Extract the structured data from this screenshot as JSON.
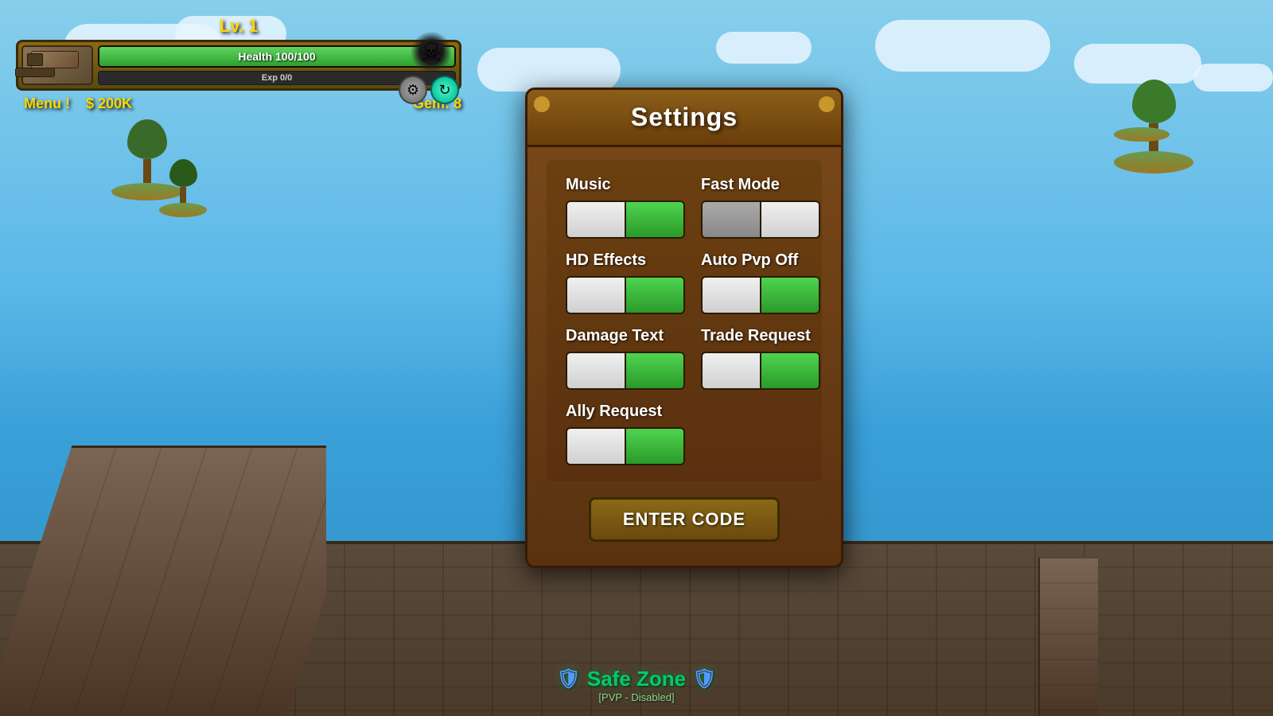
{
  "background": {
    "sky_top": "#87CEEB",
    "sky_bottom": "#3AA0D8",
    "ocean_color": "#2E8EC4"
  },
  "hud": {
    "level_label": "Lv. 1",
    "health_label": "Health 100/100",
    "health_percent": 100,
    "exp_label": "Exp 0/0",
    "exp_percent": 0,
    "menu_label": "Menu !",
    "money_label": "$ 200K",
    "gem_label": "Gem: 8"
  },
  "settings": {
    "title": "Settings",
    "items": [
      {
        "label": "Music",
        "state": "on",
        "left_gray": false
      },
      {
        "label": "Fast Mode",
        "state": "off",
        "left_gray": true
      },
      {
        "label": "HD Effects",
        "state": "on",
        "left_gray": false
      },
      {
        "label": "Auto Pvp Off",
        "state": "on",
        "left_gray": false
      },
      {
        "label": "Damage Text",
        "state": "on",
        "left_gray": false
      },
      {
        "label": "Trade Request",
        "state": "on",
        "left_gray": false
      },
      {
        "label": "Ally Request",
        "state": "on",
        "left_gray": false
      }
    ],
    "enter_code_label": "ENTER CODE"
  },
  "safe_zone": {
    "text": "Safe Zone",
    "pvp_label": "[PVP - Disabled]"
  }
}
